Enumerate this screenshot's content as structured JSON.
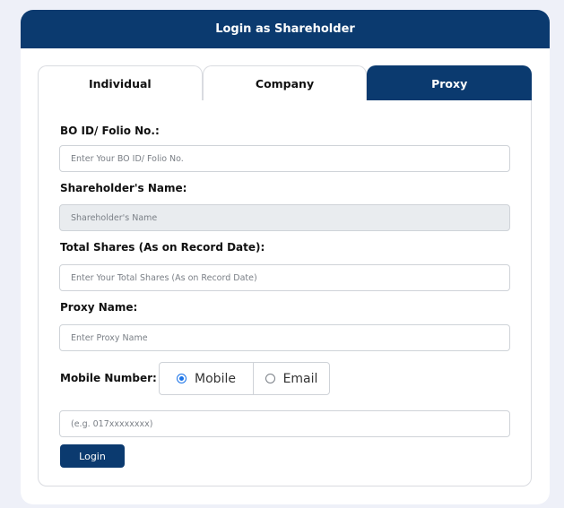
{
  "header": {
    "title": "Login as Shareholder"
  },
  "tabs": [
    {
      "label": "Individual",
      "active": false
    },
    {
      "label": "Company",
      "active": false
    },
    {
      "label": "Proxy",
      "active": true
    }
  ],
  "form": {
    "bo_id": {
      "label": "BO ID/ Folio No.:",
      "placeholder": "Enter Your BO ID/ Folio No.",
      "value": ""
    },
    "shareholder_name": {
      "label": "Shareholder's Name:",
      "placeholder": "Shareholder's Name",
      "value": ""
    },
    "total_shares": {
      "label": "Total Shares (As on Record Date):",
      "placeholder": "Enter Your Total Shares (As on Record Date)",
      "value": ""
    },
    "proxy_name": {
      "label": "Proxy Name:",
      "placeholder": "Enter Proxy Name",
      "value": ""
    },
    "contact": {
      "label": "Mobile Number:",
      "options": [
        {
          "label": "Mobile",
          "checked": true
        },
        {
          "label": "Email",
          "checked": false
        }
      ],
      "placeholder": "(e.g. 017xxxxxxxx)",
      "value": ""
    },
    "login_label": "Login"
  },
  "colors": {
    "primary": "#0b3a6f",
    "radio_accent": "#1a73e8",
    "background": "#eef0f8"
  }
}
